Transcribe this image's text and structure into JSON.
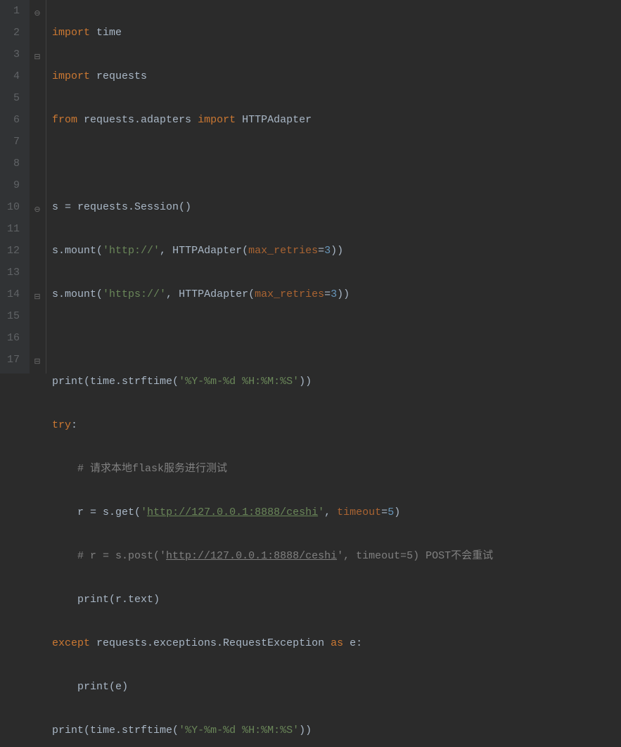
{
  "lines": {
    "l1": {
      "num": "1"
    },
    "l2": {
      "num": "2"
    },
    "l3": {
      "num": "3"
    },
    "l4": {
      "num": "4"
    },
    "l5": {
      "num": "5"
    },
    "l6": {
      "num": "6"
    },
    "l7": {
      "num": "7"
    },
    "l8": {
      "num": "8"
    },
    "l9": {
      "num": "9"
    },
    "l10": {
      "num": "10"
    },
    "l11": {
      "num": "11"
    },
    "l12": {
      "num": "12"
    },
    "l13": {
      "num": "13"
    },
    "l14": {
      "num": "14"
    },
    "l15": {
      "num": "15"
    },
    "l16": {
      "num": "16"
    },
    "l17": {
      "num": "17"
    }
  },
  "kw": {
    "import": "import",
    "from": "from",
    "try": "try",
    "except": "except",
    "as": "as"
  },
  "tok": {
    "time": "time",
    "requests": "requests",
    "requests_adapters": "requests.adapters",
    "HTTPAdapter": "HTTPAdapter",
    "s": "s",
    "eq": " = ",
    "Session": "requests.Session()",
    "mount": ".mount(",
    "http": "'http://'",
    "https": "'https://'",
    "comma": ", ",
    "HTTPAdapter_open": "HTTPAdapter(",
    "max_retries": "max_retries",
    "eq3": "=",
    "three": "3",
    "close2": "))",
    "print": "print",
    "open": "(",
    "close": ")",
    "strftime": "time.strftime(",
    "fmt": "'%Y-%m-%d %H:%M:%S'",
    "closep": "))",
    "colon": ":",
    "comment_flask": "# 请求本地flask服务进行测试",
    "r": "r",
    "get": "s.get(",
    "url": "http://127.0.0.1:8888/ceshi",
    "q": "'",
    "timeout": "timeout",
    "five": "5",
    "comment_post_pre": "# r = s.post('",
    "comment_post_suf": "', timeout=5) POST不会重试",
    "rtext": "r.text",
    "exceptions": "requests.exceptions.RequestException",
    "e": "e"
  }
}
